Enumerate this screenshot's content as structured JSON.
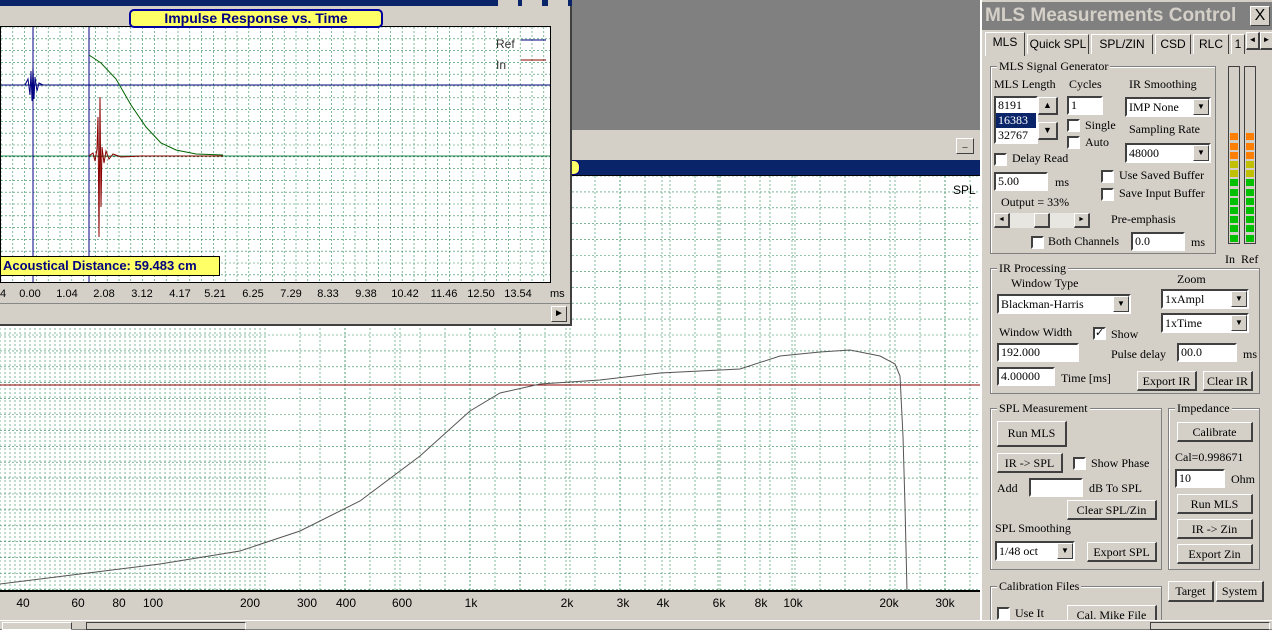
{
  "ir_window": {
    "title": "Impulse Response vs. Time",
    "legend_ref": "Ref",
    "legend_in": "In",
    "acoustic_distance": "Acoustical Distance: 59.483 cm",
    "x_ticks": [
      "4",
      "0.00",
      "1.04",
      "2.08",
      "3.12",
      "4.17",
      "5.21",
      "6.25",
      "7.29",
      "8.33",
      "9.38",
      "10.42",
      "11.46",
      "12.50",
      "13.54"
    ],
    "x_unit": "ms"
  },
  "spl_window": {
    "corner_label": "SPL",
    "x_ticks": [
      "40",
      "60",
      "80",
      "100",
      "200",
      "300",
      "400",
      "600",
      "1k",
      "2k",
      "3k",
      "4k",
      "6k",
      "8k",
      "10k",
      "20k",
      "30k"
    ]
  },
  "mls": {
    "title": "MLS Measurements Control",
    "close": "X",
    "tabs": [
      "MLS",
      "Quick SPL",
      "SPL/ZIN",
      "CSD",
      "RLC",
      "1"
    ],
    "tab_scroll_left": "◄",
    "tab_scroll_right": "►",
    "signal_group": "MLS Signal Generator",
    "mls_length_label": "MLS Length",
    "mls_lengths": [
      "8191",
      "16383",
      "32767"
    ],
    "cycles_label": "Cycles",
    "cycles": "1",
    "single": "Single",
    "auto": "Auto",
    "ir_smoothing_label": "IR Smoothing",
    "ir_smoothing": "IMP None",
    "sampling_rate_label": "Sampling Rate",
    "sampling_rate": "48000",
    "delay_read": "Delay Read",
    "delay_value": "5.00",
    "ms": "ms",
    "use_saved": "Use Saved Buffer",
    "save_input": "Save Input Buffer",
    "output": "Output = 33%",
    "preemphasis": "Pre-emphasis",
    "both_channels": "Both Channels",
    "both_value": "0.0",
    "meter_in": "In",
    "meter_ref": "Ref",
    "ir_group": "IR Processing",
    "window_type_label": "Window Type",
    "window_type": "Blackman-Harris",
    "zoom_label": "Zoom",
    "zoom_ampl": "1xAmpl",
    "zoom_time": "1xTime",
    "window_width_label": "Window Width",
    "show": "Show",
    "window_width": "192.000",
    "pulse_delay_label": "Pulse delay",
    "pulse_delay": "00.0",
    "time_value": "4.00000",
    "time_label": "Time [ms]",
    "export_ir": "Export IR",
    "clear_ir": "Clear IR",
    "spl_group": "SPL Measurement",
    "run_mls": "Run MLS",
    "ir_spl": "IR -> SPL",
    "show_phase": "Show Phase",
    "add": "Add",
    "db_to_spl": "dB  To SPL",
    "clear_spl": "Clear SPL/Zin",
    "spl_smoothing_label": "SPL Smoothing",
    "spl_smoothing": "1/48 oct",
    "export_spl": "Export SPL",
    "imp_group": "Impedance",
    "calibrate": "Calibrate",
    "cal_value": "Cal=0.998671",
    "ohm_value": "10",
    "ohm": "Ohm",
    "imp_run_mls": "Run MLS",
    "ir_zin": "IR -> Zin",
    "export_zin": "Export Zin",
    "cal_files_group": "Calibration Files",
    "use_it": "Use It",
    "cal_mike": "Cal. Mike File",
    "target": "Target",
    "system": "System"
  }
}
